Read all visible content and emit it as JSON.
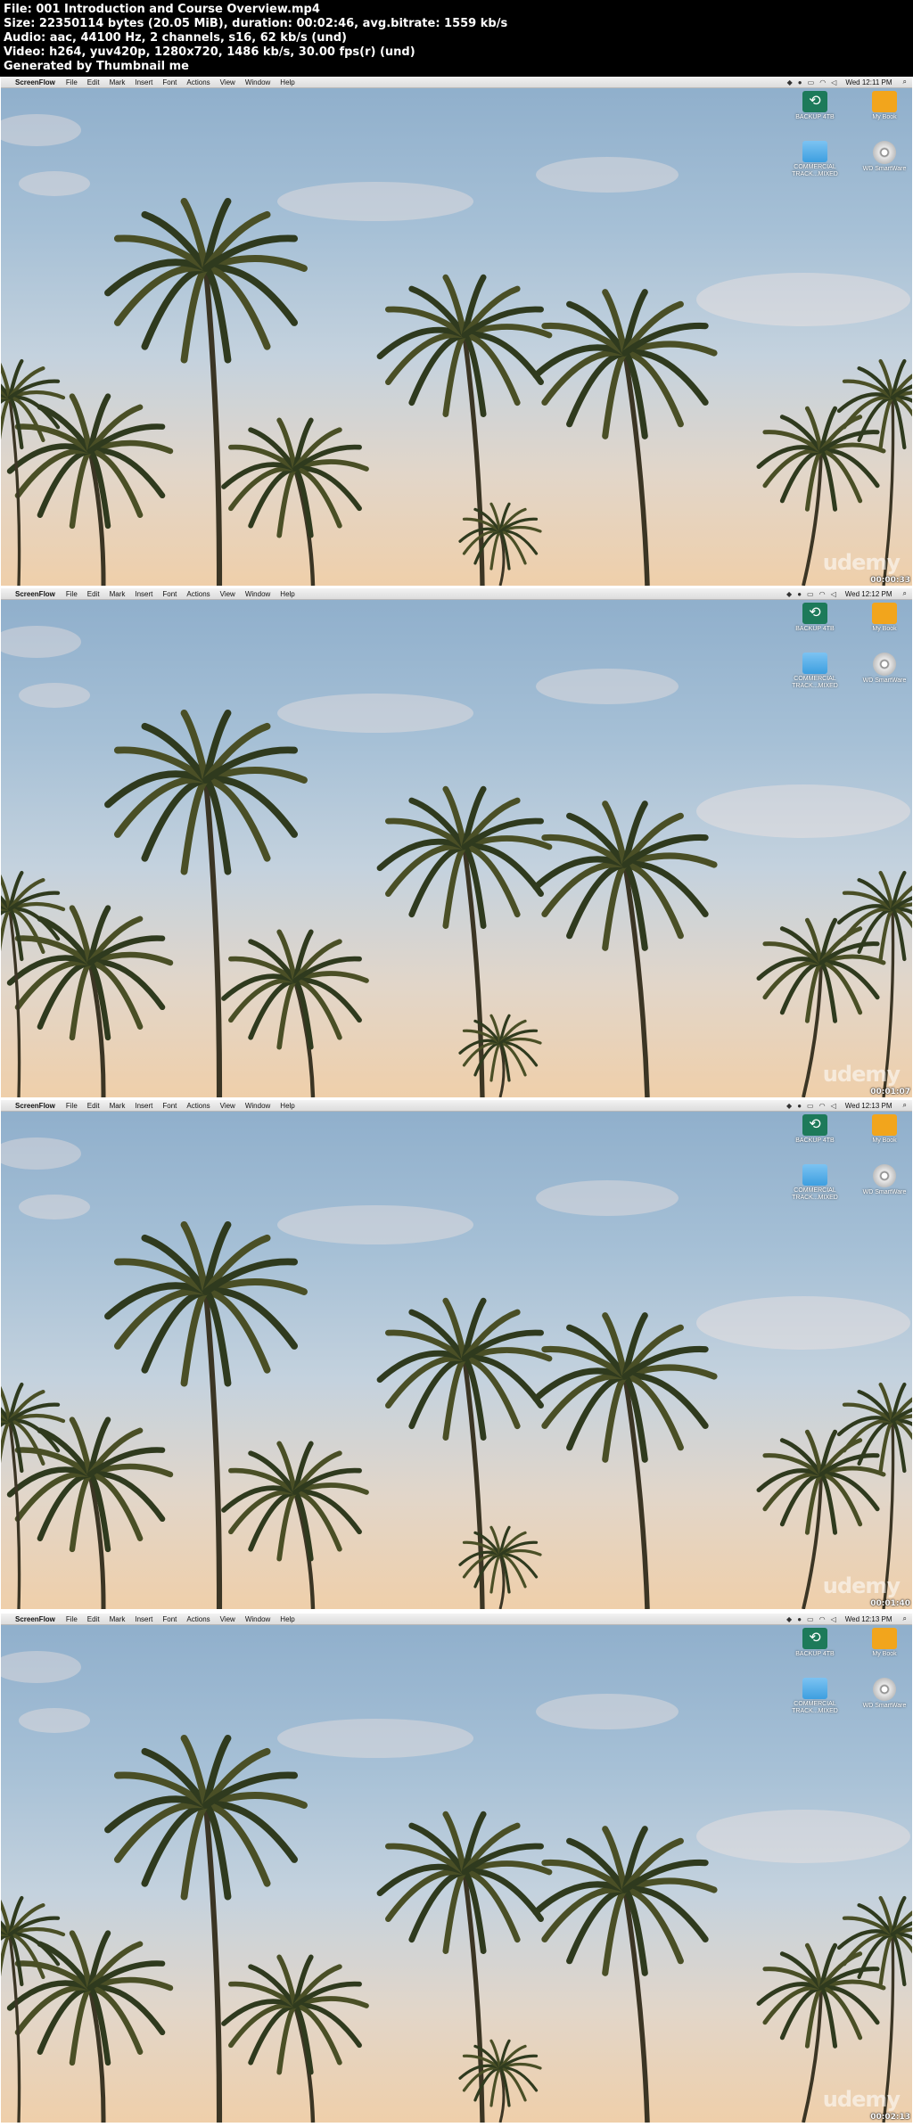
{
  "header": {
    "file": "File: 001 Introduction and Course Overview.mp4",
    "size": "Size: 22350114 bytes (20.05 MiB), duration: 00:02:46, avg.bitrate: 1559 kb/s",
    "audio": "Audio: aac, 44100 Hz, 2 channels, s16, 62 kb/s (und)",
    "video": "Video: h264, yuv420p, 1280x720, 1486 kb/s, 30.00 fps(r) (und)",
    "generator": "Generated by Thumbnail me"
  },
  "menubar": {
    "apple_icon": "",
    "app_name": "ScreenFlow",
    "items": [
      "File",
      "Edit",
      "Mark",
      "Insert",
      "Font",
      "Actions",
      "View",
      "Window",
      "Help"
    ],
    "search_icon": "⌕"
  },
  "desktop_icons": {
    "backup": "BACKUP 4TB",
    "book": "My Book",
    "folder": "COMMERCIAL TRACK...MIXED",
    "disc": "WD SmartWare"
  },
  "watermark": "udemy",
  "frames": [
    {
      "clock": "Wed 12:11 PM",
      "timestamp": "00:00:33"
    },
    {
      "clock": "Wed 12:12 PM",
      "timestamp": "00:01:07"
    },
    {
      "clock": "Wed 12:13 PM",
      "timestamp": "00:01:40"
    },
    {
      "clock": "Wed 12:13 PM",
      "timestamp": "00:02:13"
    }
  ]
}
